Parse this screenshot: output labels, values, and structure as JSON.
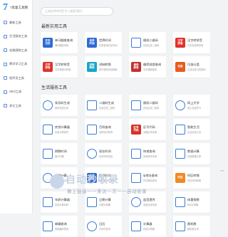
{
  "logo": {
    "mark": "7",
    "text": "7息复工具网"
  },
  "sidebar": {
    "items": [
      {
        "label": "最新工具"
      },
      {
        "label": "生活服务工具"
      },
      {
        "label": "金融理财工具"
      },
      {
        "label": "教学学习工具"
      },
      {
        "label": "程序员工具"
      },
      {
        "label": "SEO工具"
      },
      {
        "label": "其它工具"
      }
    ]
  },
  "search": {
    "placeholder": "工具名称/拼音/字 | 搜索/换行"
  },
  "sections": [
    {
      "title": "最新实用工具",
      "cards": [
        {
          "icon": "天天\n日历",
          "color": "#2d6bd3",
          "name": "神马翻查查询",
          "desc": "海外翻查询查"
        },
        {
          "icon": "世界\n时间",
          "color": "#2d6bd3",
          "name": "世界时间",
          "desc": "世界各地时区时间"
        },
        {
          "icon": "",
          "color": "#e8ecf3",
          "name": "随机二维码",
          "desc": "在线生成二维码"
        },
        {
          "icon": "汉字\n拼音",
          "color": "#e0332b",
          "name": "汉字转拼音",
          "desc": "汉字在线转拼音"
        },
        {
          "icon": "汉字\n拼音",
          "color": "#e0332b",
          "name": "汉字转拼音",
          "desc": "汉字转换为拼音"
        },
        {
          "icon": "进制\n转换",
          "color": "#19a4c8",
          "name": "进制转换",
          "desc": "数字进制在线转换"
        },
        {
          "icon": "偏旁\n部首",
          "color": "#c62f2f",
          "name": "偏旁部首查询",
          "desc": "汉字偏旁部首"
        },
        {
          "icon": "垃圾",
          "color": "#e85a1f",
          "name": "垃圾分类",
          "desc": "生活垃圾分类查询"
        }
      ]
    },
    {
      "title": "生活服务工具",
      "cards": [
        {
          "icon": "",
          "color": "#e8ecf3",
          "name": "条形码生成",
          "desc": "条码在线生成"
        },
        {
          "icon": "",
          "color": "#e8ecf3",
          "name": "二维码生成",
          "desc": "在线生成二维码"
        },
        {
          "icon": "",
          "color": "#e8ecf3",
          "name": "随机二维码",
          "desc": "在线生成二维码"
        },
        {
          "icon": "",
          "color": "#e8ecf3",
          "name": "网上大学",
          "desc": "网上在线学习"
        },
        {
          "icon": "",
          "color": "#e8ecf3",
          "name": "房贷计算器",
          "desc": "在线计算房贷"
        },
        {
          "icon": "",
          "color": "#e8ecf3",
          "name": "百科查询",
          "desc": "百科知识查询"
        },
        {
          "icon": "区号\n代码",
          "color": "#d8322a",
          "name": "区号代码",
          "desc": "全国区号查询"
        },
        {
          "icon": "",
          "color": "#e8ecf3",
          "name": "智能生活",
          "desc": "生活实用工具"
        },
        {
          "icon": "",
          "color": "#e8ecf3",
          "name": "倒数时间",
          "desc": "倒计时器"
        },
        {
          "icon": "",
          "color": "#e8ecf3",
          "name": "现在时间",
          "desc": "北京时间在线"
        },
        {
          "icon": "",
          "color": "#e8ecf3",
          "name": "快递查询",
          "desc": "快递单号查询"
        },
        {
          "icon": "",
          "color": "#e8ecf3",
          "name": "数据计算",
          "desc": "在线数据计算"
        },
        {
          "icon": "",
          "color": "#e8ecf3",
          "name": "日期计算",
          "desc": "日期间隔计算"
        },
        {
          "icon": "世界\n时间",
          "color": "#2d6bd3",
          "name": "世界时间",
          "desc": "世界各地时间"
        },
        {
          "icon": "",
          "color": "#e8ecf3",
          "name": "ip地址查询",
          "desc": "IP归属地查询"
        },
        {
          "icon": "时区",
          "color": "#f08a24",
          "name": "时区转换",
          "desc": "时区时间转换"
        },
        {
          "icon": "",
          "color": "#e8ecf3",
          "name": "年龄计算器",
          "desc": "在线计算年龄"
        },
        {
          "icon": "",
          "color": "#e8ecf3",
          "name": "日期计算",
          "desc": "日期计算器"
        },
        {
          "icon": "",
          "color": "#e8ecf3",
          "name": "血型遗传",
          "desc": "血型遗传查询"
        },
        {
          "icon": "",
          "color": "#e8ecf3",
          "name": "体重指数",
          "desc": "BMI计算器"
        },
        {
          "icon": "",
          "color": "#e8ecf3",
          "name": "邮编查询",
          "desc": "邮政编码查询"
        },
        {
          "icon": "",
          "color": "#e8ecf3",
          "name": "日历",
          "desc": "万年历查询"
        },
        {
          "icon": "",
          "color": "#e8ecf3",
          "name": "计算器",
          "desc": "在线计算器"
        },
        {
          "icon": "",
          "color": "#e8ecf3",
          "name": "随机数",
          "desc": "随机数生成"
        }
      ]
    }
  ],
  "watermark": {
    "title": "自动秒收录",
    "subtitle": "做上链接一一来访一次一一自动收录"
  },
  "back_to_top": "︿"
}
